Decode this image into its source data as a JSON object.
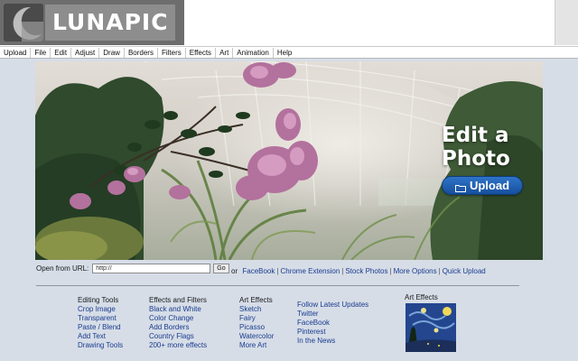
{
  "logo": {
    "text": "LUNAPIC",
    "icon": "crescent-moon-icon"
  },
  "menu": [
    "Upload",
    "File",
    "Edit",
    "Adjust",
    "Draw",
    "Borders",
    "Filters",
    "Effects",
    "Art",
    "Animation",
    "Help"
  ],
  "hero": {
    "title_line1": "Edit a",
    "title_line2": "Photo",
    "upload_label": "Upload",
    "upload_icon": "folder-icon"
  },
  "url_form": {
    "label": "Open from URL:",
    "value": "http://",
    "go_label": "Go"
  },
  "links": {
    "prefix": "or",
    "items": [
      "FaceBook",
      "Chrome Extension",
      "Stock Photos",
      "More Options",
      "Quick Upload"
    ]
  },
  "footer": {
    "editing": {
      "heading": "Editing Tools",
      "items": [
        "Crop Image",
        "Transparent",
        "Paste / Blend",
        "Add Text",
        "Drawing Tools"
      ]
    },
    "effects": {
      "heading": "Effects and Filters",
      "items": [
        "Black and White",
        "Color Change",
        "Add Borders",
        "Country Flags",
        "200+ more effects"
      ]
    },
    "art": {
      "heading": "Art Effects",
      "items": [
        "Sketch",
        "Fairy",
        "Picasso",
        "Watercolor",
        "More Art"
      ]
    },
    "follow": {
      "items": [
        "Follow Latest Updates",
        "Twitter",
        "FaceBook",
        "Pinterest",
        "In the News"
      ]
    },
    "art_preview": {
      "heading": "Art Effects"
    }
  },
  "colors": {
    "accent_blue": "#1f5fb5",
    "link": "#1a3c8f",
    "page_bg": "#d6dde7"
  }
}
